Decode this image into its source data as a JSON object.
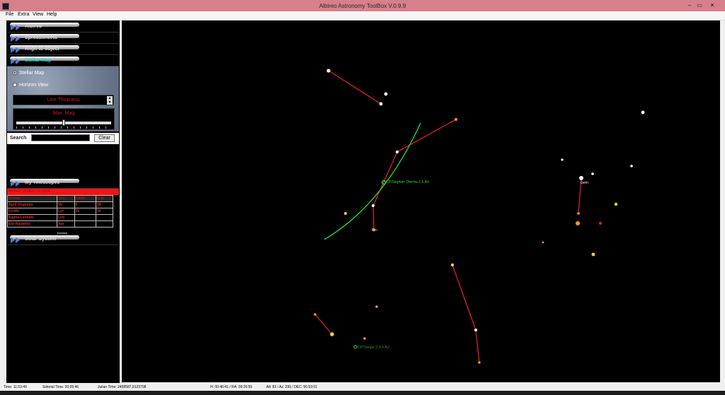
{
  "window": {
    "title": "Albireo Astronomy ToolBox V.0.9.9",
    "controls": [
      "–",
      "▭",
      "✕"
    ]
  },
  "menu": [
    "File",
    "Extra",
    "View",
    "Help"
  ],
  "sidebar": {
    "sections": [
      {
        "label": "Albireo",
        "active": false
      },
      {
        "label": "Spreadsheets",
        "active": false
      },
      {
        "label": "Align to object",
        "active": false
      },
      {
        "label": "Stellar Map",
        "active": true
      }
    ],
    "stellar": {
      "options": [
        {
          "label": "Stellar Map",
          "selected": true
        },
        {
          "label": "Horizon View",
          "selected": false
        }
      ],
      "line_thickness": "Line Thickness",
      "max_mag": "Max. Mag",
      "max_mag_level": 0.5
    },
    "search": {
      "label": "Search",
      "value": "",
      "clear": "Clear"
    },
    "telescopes": {
      "label": "My Telescopes"
    },
    "meteor": {
      "header": "Meteor shower in April",
      "columns": [
        "Shower",
        "Con.",
        "#Moth",
        "Enth"
      ],
      "rows": [
        [
          "April-Virginids",
          "Vir",
          "6",
          "28"
        ],
        [
          "Lyrids",
          "Lyr",
          "16",
          "50"
        ],
        [
          "Sigma-Leonids",
          "Leo",
          "",
          ""
        ],
        [
          "Eta-Aquarids",
          "Aqr",
          "",
          ""
        ]
      ]
    },
    "solar": {
      "label": "Solar System"
    }
  },
  "skymap": {
    "labels": {
      "comet1": "CP/Stephan Oterma 2,5 AU",
      "comet2": "CP/Tempel 2 4,4 AU",
      "lyn": "Lyn",
      "gem": "Gem"
    },
    "colors": {
      "constellation": "#e02020",
      "comet": "#2ad42a",
      "star_white": "#ffffff",
      "star_yellow": "#ffd21a",
      "star_orange": "#ff9a1a"
    }
  },
  "status": {
    "time": "Time: 11:53:49",
    "sidereal": "Siderial Time: 00:05:46",
    "julian": "Julian Time: 2458587,9123708",
    "hra": "H: 00:46:41 / RA: 09:26:55",
    "altaz": "Alt: 83 / Az: 299 / DEC: 56:53:01"
  }
}
